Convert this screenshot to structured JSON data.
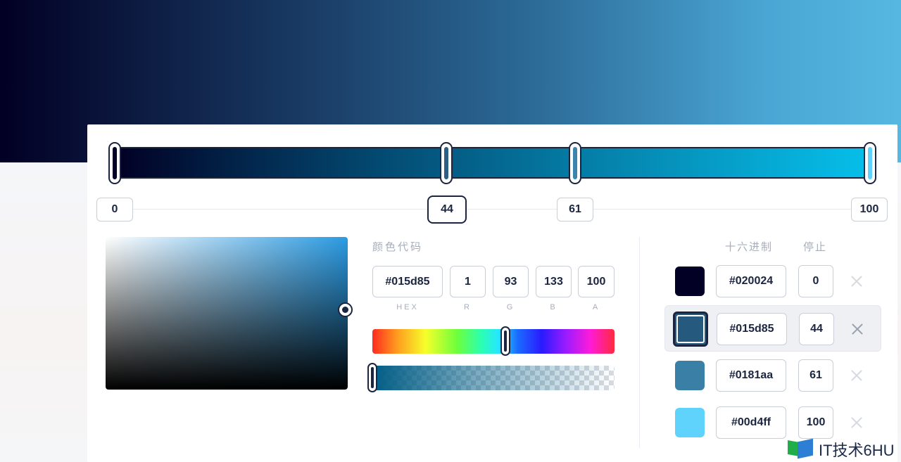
{
  "gradient": {
    "stops": [
      {
        "position": 0,
        "color": "#020024"
      },
      {
        "position": 44,
        "color": "#015d85"
      },
      {
        "position": 61,
        "color": "#0181aa"
      },
      {
        "position": 100,
        "color": "#00d4ff"
      }
    ],
    "stop_labels": [
      "0",
      "44",
      "61",
      "100"
    ],
    "active_stop_index": 1
  },
  "color_code": {
    "section_title": "颜色代码",
    "hex": "#015d85",
    "r": "1",
    "g": "93",
    "b": "133",
    "a": "100",
    "labels": {
      "hex": "HEX",
      "r": "R",
      "g": "G",
      "b": "B",
      "a": "A"
    }
  },
  "stop_list": {
    "header_hex": "十六进制",
    "header_stop": "停止",
    "rows": [
      {
        "color": "#020024",
        "hex": "#020024",
        "stop": "0",
        "selected": false
      },
      {
        "color": "#25597d",
        "hex": "#015d85",
        "stop": "44",
        "selected": true
      },
      {
        "color": "#3a7fa6",
        "hex": "#0181aa",
        "stop": "61",
        "selected": false
      },
      {
        "color": "#5fd3fb",
        "hex": "#00d4ff",
        "stop": "100",
        "selected": false
      }
    ]
  },
  "picker": {
    "hue_level": 0.54,
    "alpha_level": 1.0
  },
  "watermark": {
    "text": "IT技术6HU"
  }
}
